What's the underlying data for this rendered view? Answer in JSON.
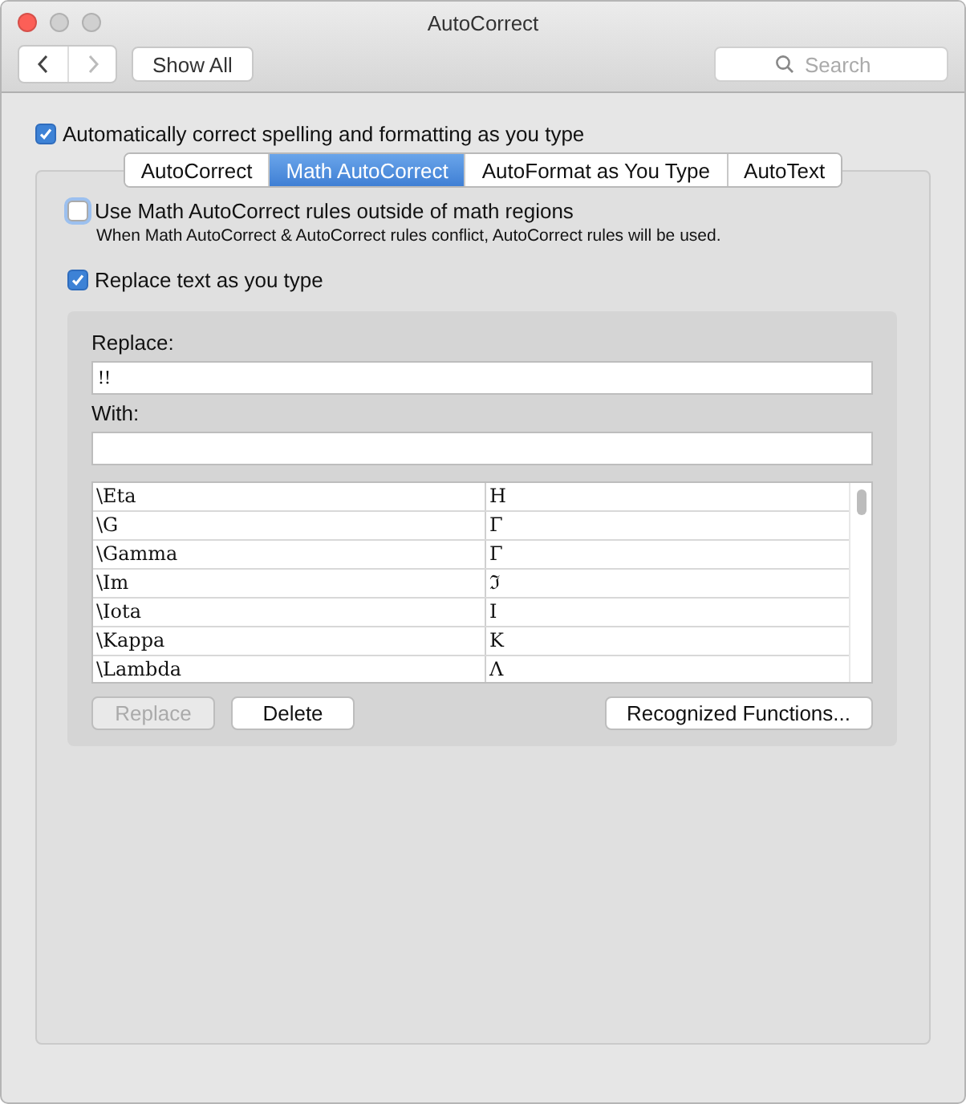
{
  "window": {
    "title": "AutoCorrect"
  },
  "toolbar": {
    "back_disabled": false,
    "forward_disabled": true,
    "show_all": "Show All",
    "search_placeholder": "Search"
  },
  "auto_correct_option": {
    "label": "Automatically correct spelling and formatting as you type",
    "checked": true
  },
  "tabs": [
    {
      "label": "AutoCorrect",
      "selected": false
    },
    {
      "label": "Math AutoCorrect",
      "selected": true
    },
    {
      "label": "AutoFormat as You Type",
      "selected": false
    },
    {
      "label": "AutoText",
      "selected": false
    }
  ],
  "math_outside_option": {
    "label": "Use Math AutoCorrect rules outside of math regions",
    "checked": false,
    "note": "When Math AutoCorrect & AutoCorrect rules conflict, AutoCorrect rules will be used."
  },
  "replace_option": {
    "label": "Replace text as you type",
    "checked": true
  },
  "replace_field": {
    "label": "Replace:",
    "value": "!!"
  },
  "with_field": {
    "label": "With:"
  },
  "table": {
    "rows": [
      {
        "replace": "\\Eta",
        "with": "Η"
      },
      {
        "replace": "\\G",
        "with": "Γ"
      },
      {
        "replace": "\\Gamma",
        "with": "Γ"
      },
      {
        "replace": "\\Im",
        "with": "ℑ"
      },
      {
        "replace": "\\Iota",
        "with": "Ι"
      },
      {
        "replace": "\\Kappa",
        "with": "Κ"
      },
      {
        "replace": "\\Lambda",
        "with": "Λ"
      }
    ]
  },
  "buttons": [
    {
      "label": "Replace",
      "disabled": true
    },
    {
      "label": "Delete",
      "disabled": false
    },
    {
      "label": "Recognized Functions...",
      "disabled": false
    }
  ]
}
